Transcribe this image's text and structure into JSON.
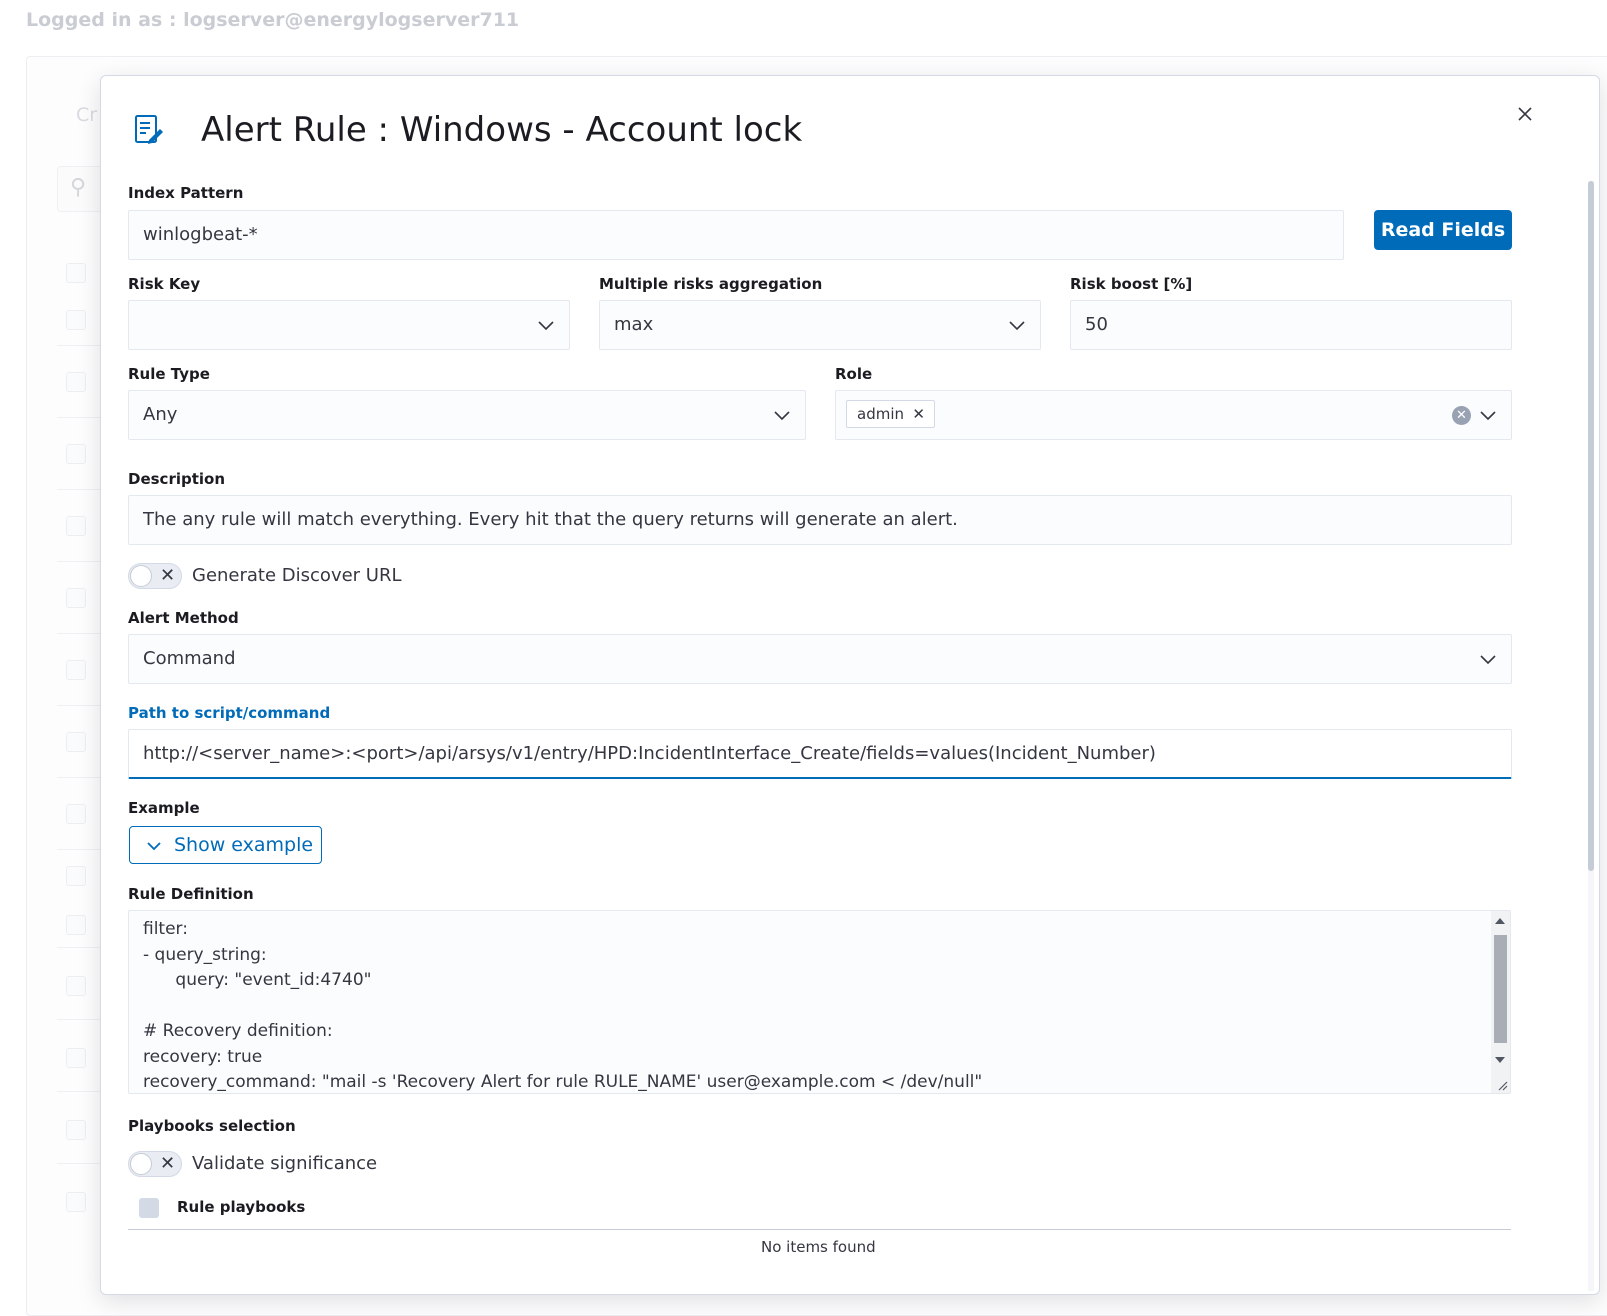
{
  "header": {
    "logged_in_text": "Logged in as : logserver@energylogserver711"
  },
  "background": {
    "breadcrumb_fragment": "Cr"
  },
  "modal": {
    "title": "Alert Rule : Windows - Account lock",
    "icon": "document-edit-icon",
    "close_icon": "close-icon"
  },
  "form": {
    "index_pattern": {
      "label": "Index Pattern",
      "value": "winlogbeat-*"
    },
    "read_fields_button": "Read Fields",
    "risk_key": {
      "label": "Risk Key",
      "value": ""
    },
    "risk_aggregation": {
      "label": "Multiple risks aggregation",
      "value": "max"
    },
    "risk_boost": {
      "label": "Risk boost [%]",
      "value": "50"
    },
    "rule_type": {
      "label": "Rule Type",
      "value": "Any"
    },
    "role": {
      "label": "Role",
      "chips": [
        "admin"
      ]
    },
    "description": {
      "label": "Description",
      "value": "The any rule will match everything. Every hit that the query returns will generate an alert."
    },
    "generate_discover_url": {
      "label": "Generate Discover URL",
      "checked": false
    },
    "alert_method": {
      "label": "Alert Method",
      "value": "Command"
    },
    "script_path": {
      "label": "Path to script/command",
      "value": "http://<server_name>:<port>/api/arsys/v1/entry/HPD:IncidentInterface_Create/fields=values(Incident_Number)"
    },
    "example": {
      "label": "Example",
      "button": "Show example"
    },
    "rule_definition": {
      "label": "Rule Definition",
      "lines": [
        "filter:",
        "- query_string:",
        "      query: \"event_id:4740\"",
        "",
        "# Recovery definition:",
        "recovery: true",
        "recovery_command: \"mail -s 'Recovery Alert for rule RULE_NAME' user@example.com < /dev/null\""
      ]
    },
    "playbooks": {
      "label": "Playbooks selection",
      "validate_significance": {
        "label": "Validate significance",
        "checked": false
      },
      "rule_playbooks_header": "Rule playbooks",
      "empty_text": "No items found"
    }
  },
  "colors": {
    "primary": "#006bb8",
    "text": "#343741",
    "border": "#e4e8ef"
  }
}
